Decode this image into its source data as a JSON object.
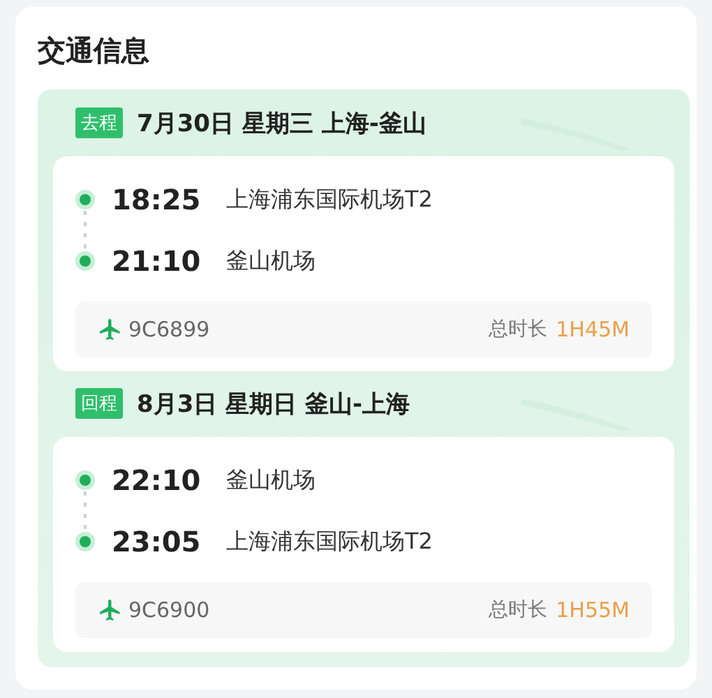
{
  "title": "交通信息",
  "legs": [
    {
      "tag": "去程",
      "date": "7月30日 星期三 上海-釜山",
      "stops": [
        {
          "time": "18:25",
          "place": "上海浦东国际机场T2"
        },
        {
          "time": "21:10",
          "place": "釜山机场"
        }
      ],
      "flight": "9C6899",
      "duration_label": "总时长",
      "duration": "1H45M"
    },
    {
      "tag": "回程",
      "date": "8月3日 星期日 釜山-上海",
      "stops": [
        {
          "time": "22:10",
          "place": "釜山机场"
        },
        {
          "time": "23:05",
          "place": "上海浦东国际机场T2"
        }
      ],
      "flight": "9C6900",
      "duration_label": "总时长",
      "duration": "1H55M"
    }
  ]
}
